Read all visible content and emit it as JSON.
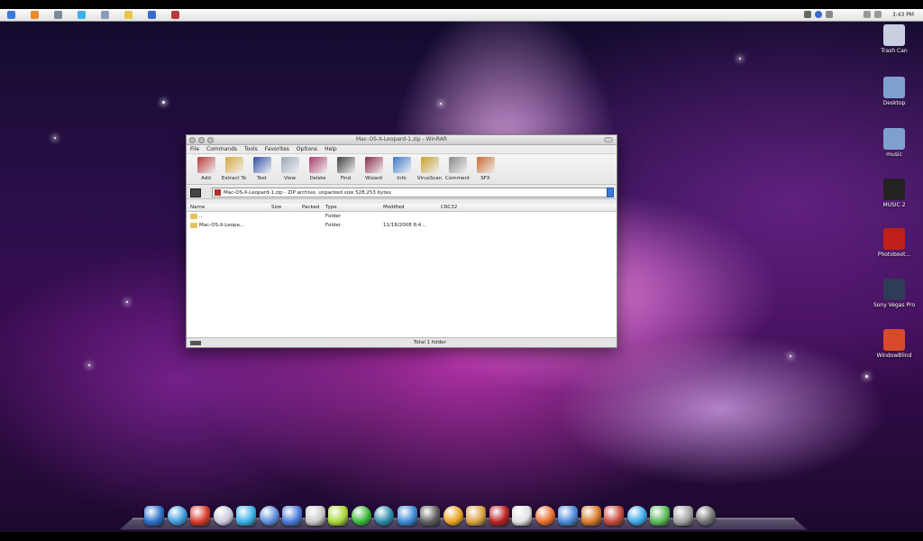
{
  "menubar": {
    "left_icons": [
      "apple-icon",
      "firefox-icon",
      "app-icon",
      "skype-icon",
      "app-icon",
      "notes-icon",
      "globe-icon",
      "app-icon"
    ],
    "clock": "3:43 PM"
  },
  "desktop_icons": [
    {
      "name": "trash-icon",
      "label": "Trash Can",
      "color": "#c8cfe0"
    },
    {
      "name": "desktop-folder-icon",
      "label": "Desktop",
      "color": "#7f9fd0"
    },
    {
      "name": "music-folder-icon",
      "label": "music",
      "color": "#7f9fd0"
    },
    {
      "name": "music2-icon",
      "label": "MUSIC 2",
      "color": "#222222"
    },
    {
      "name": "photobooth-icon",
      "label": "Photoboot...",
      "color": "#c0201a"
    },
    {
      "name": "sony-vegas-icon",
      "label": "Sony Vegas Pro",
      "color": "#2e3d55"
    },
    {
      "name": "windowblinds-icon",
      "label": "WindowBlind",
      "color": "#d84b2a"
    }
  ],
  "window": {
    "title": "Mac-OS-X-Leopard-1.zip - WinRAR",
    "menu": [
      "File",
      "Commands",
      "Tools",
      "Favorites",
      "Options",
      "Help"
    ],
    "toolbar": [
      {
        "name": "add",
        "label": "Add",
        "color": "#b83a3a"
      },
      {
        "name": "extract-to",
        "label": "Extract To",
        "color": "#d6a83a"
      },
      {
        "name": "test",
        "label": "Test",
        "color": "#2f4fa8"
      },
      {
        "name": "view",
        "label": "View",
        "color": "#9aa7b8"
      },
      {
        "name": "delete",
        "label": "Delete",
        "color": "#a83a6a"
      },
      {
        "name": "find",
        "label": "Find",
        "color": "#404040"
      },
      {
        "name": "wizard",
        "label": "Wizard",
        "color": "#8a2a4a"
      },
      {
        "name": "info",
        "label": "Info",
        "color": "#3a78c8"
      },
      {
        "name": "virusscan",
        "label": "VirusScan",
        "color": "#c8a02a"
      },
      {
        "name": "comment",
        "label": "Comment",
        "color": "#8a8a8a"
      },
      {
        "name": "sfx",
        "label": "SFX",
        "color": "#c86a2a"
      }
    ],
    "address": "Mac-OS-X-Leopard-1.zip - ZIP archive, unpacked size 528,253 bytes",
    "columns": [
      "Name",
      "Size",
      "Packed",
      "Type",
      "Modified",
      "CRC32"
    ],
    "rows": [
      {
        "name": "..",
        "type": "Folder",
        "modified": ""
      },
      {
        "name": "Mac-OS-X-Leopa...",
        "type": "Folder",
        "modified": "11/18/2008 8:4..."
      }
    ],
    "status": "Total 1 folder"
  },
  "dock": [
    "#2a6fc8",
    "#3a9ad8",
    "#d83a2a",
    "#c8c8d8",
    "#3ab0e8",
    "#5a8ad8",
    "#4a7ad8",
    "#c8c8c8",
    "#a8d838",
    "#38b838",
    "#2a8aa8",
    "#3a8ad8",
    "#606060",
    "#e8a020",
    "#d8a040",
    "#b82020",
    "#e0e0e0",
    "#e86a2a",
    "#4a8ad8",
    "#d87a2a",
    "#c84a3a",
    "#3aa8e8",
    "#58b858",
    "#a0a0a0",
    "#707070"
  ]
}
